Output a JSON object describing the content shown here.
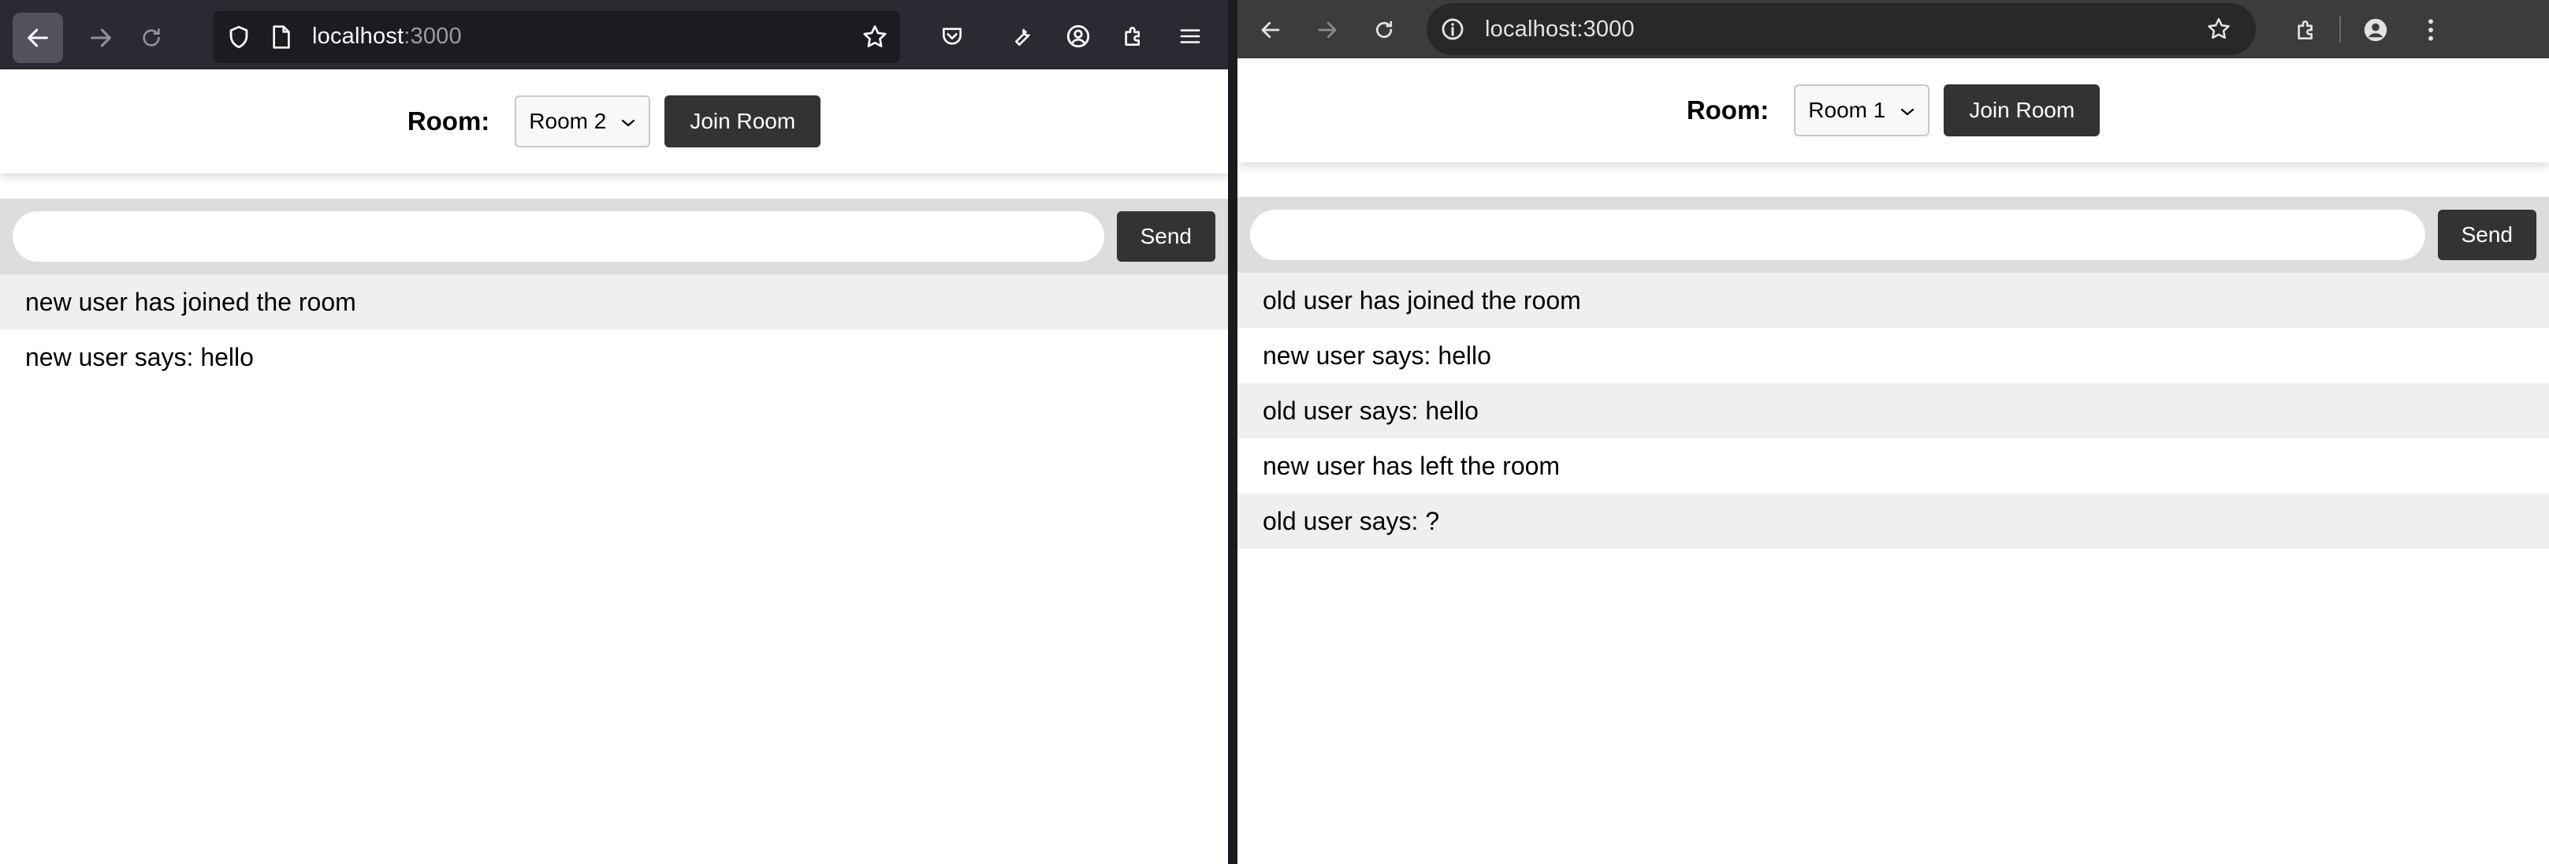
{
  "left_browser": {
    "url": {
      "host": "localhost",
      "port": ":3000"
    },
    "app": {
      "room_label": "Room:",
      "selected_room": "Room 2",
      "join_button": "Join Room",
      "input_value": "",
      "send_button": "Send",
      "messages": [
        "new user has joined the room",
        "new user says: hello"
      ]
    }
  },
  "right_browser": {
    "url": {
      "text": "localhost:3000"
    },
    "app": {
      "room_label": "Room:",
      "selected_room": "Room 1",
      "join_button": "Join Room",
      "input_value": "",
      "send_button": "Send",
      "messages": [
        "old user has joined the room",
        "new user says: hello",
        "old user says: hello",
        "new user has left the room",
        "old user says: ?"
      ]
    }
  },
  "icons": {
    "left_toolbar": [
      "back-icon",
      "forward-icon",
      "reload-icon",
      "shield-icon",
      "page-icon",
      "star-icon",
      "pocket-icon",
      "wrench-icon",
      "account-icon",
      "extensions-icon",
      "menu-icon"
    ],
    "right_toolbar": [
      "back-icon",
      "forward-icon",
      "reload-icon",
      "info-icon",
      "star-icon",
      "extensions-icon",
      "profile-icon",
      "more-icon"
    ]
  },
  "colors": {
    "firefox_toolbar": "#2b2a33",
    "chrome_toolbar": "#3c3c3c",
    "button_dark": "#333333",
    "send_bar": "#dddddd",
    "message_stripe": "#efefef"
  }
}
